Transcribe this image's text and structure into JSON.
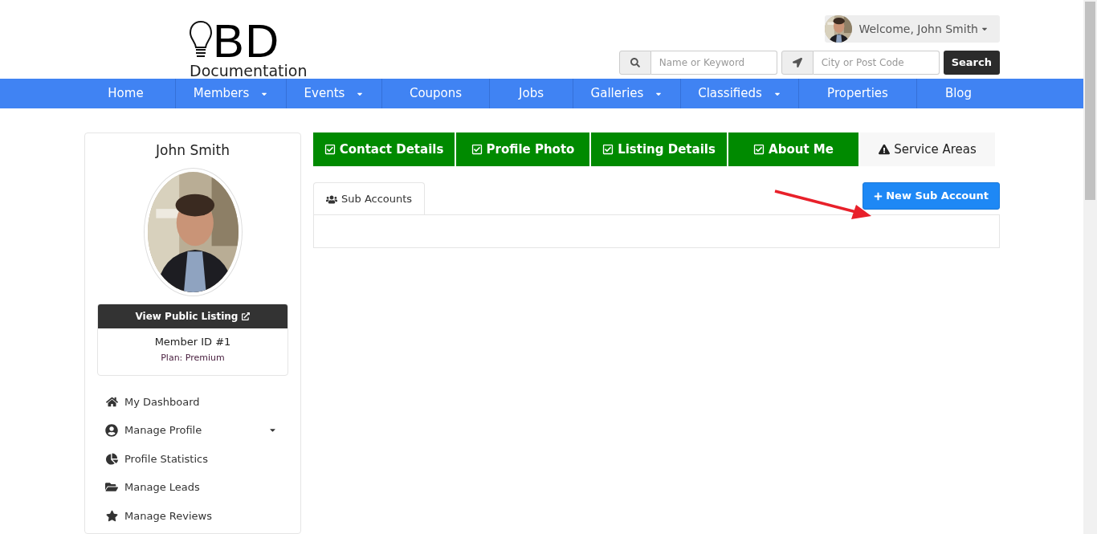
{
  "logo": {
    "letters": "BD",
    "tagline": "Documentation"
  },
  "user_menu": {
    "label": "Welcome, John Smith"
  },
  "search": {
    "keyword_placeholder": "Name or Keyword",
    "location_placeholder": "City or Post Code",
    "button": "Search"
  },
  "nav": [
    {
      "label": "Home",
      "dropdown": false
    },
    {
      "label": "Members",
      "dropdown": true
    },
    {
      "label": "Events",
      "dropdown": true
    },
    {
      "label": "Coupons",
      "dropdown": false
    },
    {
      "label": "Jobs",
      "dropdown": false
    },
    {
      "label": "Galleries",
      "dropdown": true
    },
    {
      "label": "Classifieds",
      "dropdown": true
    },
    {
      "label": "Properties",
      "dropdown": false
    },
    {
      "label": "Blog",
      "dropdown": false
    }
  ],
  "profile": {
    "name": "John Smith",
    "view_listing": "View Public Listing",
    "member_id": "Member ID #1",
    "plan": "Plan: Premium"
  },
  "sidebar": [
    {
      "label": "My Dashboard",
      "kind": "home",
      "expandable": false
    },
    {
      "label": "Manage Profile",
      "kind": "user",
      "expandable": true
    },
    {
      "label": "Profile Statistics",
      "kind": "pie",
      "expandable": false
    },
    {
      "label": "Manage Leads",
      "kind": "folder",
      "expandable": false
    },
    {
      "label": "Manage Reviews",
      "kind": "star",
      "expandable": false
    }
  ],
  "steps": [
    {
      "label": "Contact Details",
      "complete": true
    },
    {
      "label": "Profile Photo",
      "complete": true
    },
    {
      "label": "Listing Details",
      "complete": true
    },
    {
      "label": "About Me",
      "complete": true
    },
    {
      "label": "Service Areas",
      "complete": false
    }
  ],
  "tabs": [
    {
      "label": "Sub Accounts",
      "selected": true
    }
  ],
  "new_button": "New Sub Account"
}
